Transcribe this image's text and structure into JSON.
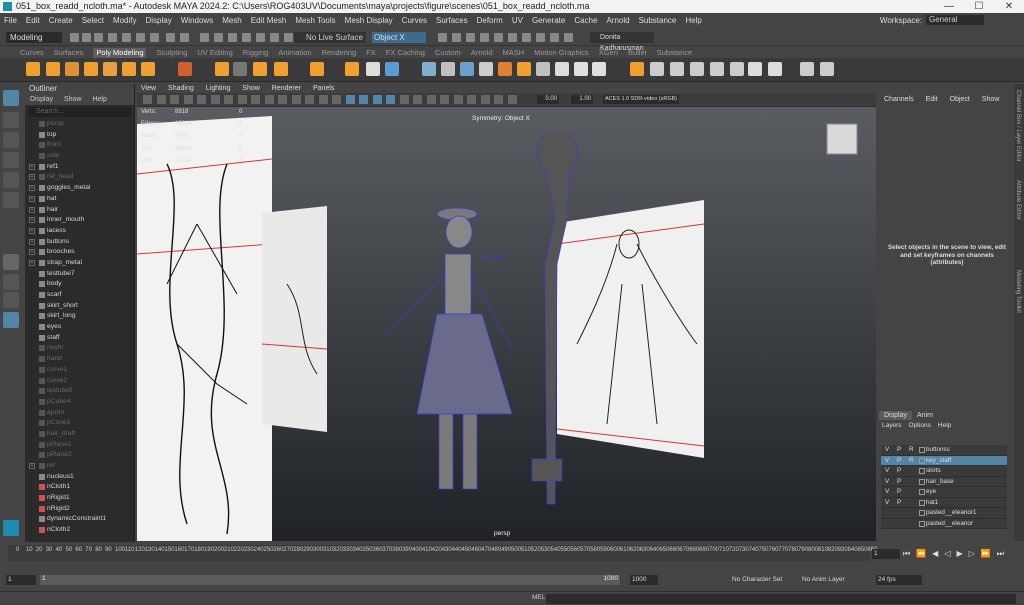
{
  "window": {
    "title": "051_box_readd_ncloth.ma* - Autodesk MAYA 2024.2: C:\\Users\\ROG403UV\\Documents\\maya\\projects\\figure\\scenes\\051_box_readd_ncloth.ma",
    "min": "—",
    "max": "☐",
    "close": "✕"
  },
  "menubar": [
    "File",
    "Edit",
    "Create",
    "Select",
    "Modify",
    "Display",
    "Windows",
    "Mesh",
    "Edit Mesh",
    "Mesh Tools",
    "Mesh Display",
    "Curves",
    "Surfaces",
    "Deform",
    "UV",
    "Generate",
    "Cache",
    "Arnold",
    "Substance",
    "Help"
  ],
  "workspace": {
    "label": "Workspace:",
    "value": "General"
  },
  "status": {
    "mode": "Modeling",
    "live_surface": "No Live Surface",
    "symmetry": "Object X",
    "user": "Donita Kadharusman"
  },
  "shelf_tabs": [
    "Curves",
    "Surfaces",
    "Poly Modeling",
    "Sculpting",
    "UV Editing",
    "Rigging",
    "Animation",
    "Rendering",
    "FX",
    "FX Caching",
    "Custom",
    "Arnold",
    "MASH",
    "Motion Graphics",
    "XGen",
    "Bullet",
    "Substance"
  ],
  "shelf_active": "Poly Modeling",
  "outliner": {
    "title": "Outliner",
    "menu": [
      "Display",
      "Show",
      "Help"
    ],
    "search_placeholder": "Search...",
    "items": [
      {
        "name": "persp",
        "dim": true,
        "exp": false
      },
      {
        "name": "top",
        "dim": false,
        "exp": false
      },
      {
        "name": "front",
        "dim": true,
        "exp": false
      },
      {
        "name": "side",
        "dim": true,
        "exp": false
      },
      {
        "name": "ref1",
        "dim": false,
        "exp": true
      },
      {
        "name": "ref_head",
        "dim": true,
        "exp": true
      },
      {
        "name": "goggles_metal",
        "dim": false,
        "exp": true
      },
      {
        "name": "hat",
        "dim": false,
        "exp": true
      },
      {
        "name": "hair",
        "dim": false,
        "exp": true
      },
      {
        "name": "inner_mouth",
        "dim": false,
        "exp": true
      },
      {
        "name": "lacess",
        "dim": false,
        "exp": true
      },
      {
        "name": "buttons",
        "dim": false,
        "exp": true
      },
      {
        "name": "brooches",
        "dim": false,
        "exp": true
      },
      {
        "name": "strap_metal",
        "dim": false,
        "exp": true
      },
      {
        "name": "testtube7",
        "dim": false,
        "exp": false
      },
      {
        "name": "body",
        "dim": false,
        "exp": false
      },
      {
        "name": "scarf",
        "dim": false,
        "exp": false
      },
      {
        "name": "skirt_short",
        "dim": false,
        "exp": false
      },
      {
        "name": "skirt_long",
        "dim": false,
        "exp": false
      },
      {
        "name": "eyes",
        "dim": false,
        "exp": false
      },
      {
        "name": "staff",
        "dim": false,
        "exp": false
      },
      {
        "name": "neyhi",
        "dim": true,
        "exp": false
      },
      {
        "name": "hand",
        "dim": true,
        "exp": false
      },
      {
        "name": "curve1",
        "dim": true,
        "exp": false
      },
      {
        "name": "curve2",
        "dim": true,
        "exp": false
      },
      {
        "name": "testube5",
        "dim": true,
        "exp": false
      },
      {
        "name": "pCube4",
        "dim": true,
        "exp": false
      },
      {
        "name": "apron",
        "dim": true,
        "exp": false
      },
      {
        "name": "pCone1",
        "dim": true,
        "exp": false
      },
      {
        "name": "hair_draft",
        "dim": true,
        "exp": false
      },
      {
        "name": "pPlane1",
        "dim": true,
        "exp": false
      },
      {
        "name": "pPlane2",
        "dim": true,
        "exp": false
      },
      {
        "name": "ref",
        "dim": true,
        "exp": true
      },
      {
        "name": "nucleus1",
        "dim": false,
        "exp": false
      },
      {
        "name": "nCloth1",
        "dim": false,
        "exp": false
      },
      {
        "name": "nRigid1",
        "dim": false,
        "exp": false
      },
      {
        "name": "nRigid2",
        "dim": false,
        "exp": false
      },
      {
        "name": "dynamicConstraint1",
        "dim": false,
        "exp": false
      },
      {
        "name": "nCloth2",
        "dim": false,
        "exp": false
      }
    ]
  },
  "viewport": {
    "menu": [
      "View",
      "Shading",
      "Lighting",
      "Show",
      "Renderer",
      "Panels"
    ],
    "hud": [
      {
        "k": "Verts:",
        "v": "8818",
        "z": "0"
      },
      {
        "k": "Edges:",
        "v": "18814",
        "z": "0"
      },
      {
        "k": "Faces:",
        "v": "9436",
        "z": "0"
      },
      {
        "k": "Tris:",
        "v": "16836",
        "z": "0"
      },
      {
        "k": "UVs:",
        "v": "12114",
        "z": "0"
      }
    ],
    "symmetry": "Symmetry: Object X",
    "camera": "persp",
    "field1": "0.00",
    "field2": "1.00",
    "colorspace": "ACES 1.0 SDR-video (sRGB)"
  },
  "channel_box": {
    "menu": [
      "Channels",
      "Edit",
      "Object",
      "Show"
    ],
    "message": "Select objects in the scene to view, edit and set keyframes on channels (attributes)"
  },
  "side_tabs": [
    "Channel Box / Layer Editor",
    "Attribute Editor",
    "Modeling Toolkit"
  ],
  "layers": {
    "tabs": [
      "Display",
      "Anim"
    ],
    "menu": [
      "Layers",
      "Options",
      "Help"
    ],
    "rows": [
      {
        "name": "buttonss",
        "sel": false
      },
      {
        "name": "key_staff",
        "sel": true
      },
      {
        "name": "skirts",
        "sel": false
      },
      {
        "name": "hair_base",
        "sel": false
      },
      {
        "name": "eye",
        "sel": false
      },
      {
        "name": "hat1",
        "sel": false
      },
      {
        "name": "pasted__eleanor1",
        "sel": false
      },
      {
        "name": "pasted__eleanor",
        "sel": false
      }
    ]
  },
  "timeline": {
    "ticks": [
      "0",
      "10",
      "20",
      "30",
      "40",
      "50",
      "60",
      "70",
      "80",
      "90",
      "100",
      "110",
      "120",
      "130",
      "140",
      "150",
      "160",
      "170",
      "180",
      "190",
      "200",
      "210",
      "220",
      "230",
      "240",
      "250",
      "260",
      "270",
      "280",
      "290",
      "300",
      "310",
      "320",
      "330",
      "340",
      "350",
      "360",
      "370",
      "380",
      "390",
      "400",
      "410",
      "420",
      "430",
      "440",
      "450",
      "460",
      "470",
      "480",
      "490",
      "500",
      "510",
      "520",
      "530",
      "540",
      "550",
      "560",
      "570",
      "580",
      "590",
      "600",
      "610",
      "620",
      "630",
      "640",
      "650",
      "660",
      "670",
      "680",
      "690",
      "700",
      "710",
      "720",
      "730",
      "740",
      "750",
      "760",
      "770",
      "780",
      "790",
      "800",
      "810",
      "820",
      "830",
      "840",
      "850",
      "860"
    ],
    "current": "1"
  },
  "range": {
    "start": "1",
    "range_start": "1",
    "range_end": "1000",
    "end": "1000",
    "character": "No Character Set",
    "anim_layer": "No Anim Layer",
    "fps": "24 fps"
  },
  "cmd": {
    "label": "MEL"
  }
}
